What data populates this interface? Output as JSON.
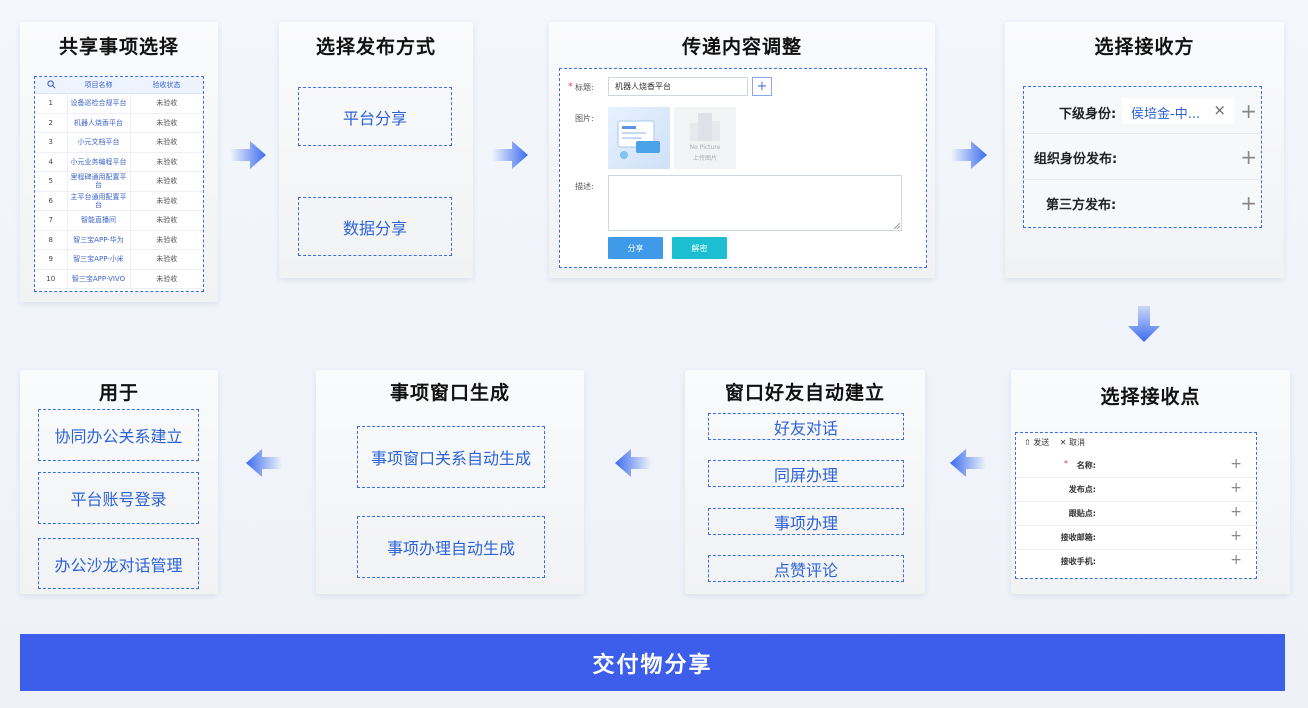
{
  "steps": {
    "s1": {
      "title": "共享事项选择",
      "table": {
        "headers": [
          "项目名称",
          "验收状态"
        ],
        "rows": [
          {
            "n": "1",
            "name": "设备巡检合规平台",
            "status": "未验收"
          },
          {
            "n": "2",
            "name": "机器人烧香平台",
            "status": "未验收"
          },
          {
            "n": "3",
            "name": "小元文档平台",
            "status": "未验收"
          },
          {
            "n": "4",
            "name": "小元业务编程平台",
            "status": "未验收"
          },
          {
            "n": "5",
            "name": "里程碑通用配置平台",
            "status": "未验收"
          },
          {
            "n": "6",
            "name": "主平台通用配置平台",
            "status": "未验收"
          },
          {
            "n": "7",
            "name": "智能直播间",
            "status": "未验收"
          },
          {
            "n": "8",
            "name": "智三宝APP-华为",
            "status": "未验收"
          },
          {
            "n": "9",
            "name": "智三宝APP-小米",
            "status": "未验收"
          },
          {
            "n": "10",
            "name": "智三宝APP-VIVO",
            "status": "未验收"
          }
        ]
      }
    },
    "s2": {
      "title": "选择发布方式",
      "items": [
        "平台分享",
        "数据分享"
      ]
    },
    "s3": {
      "title": "传递内容调整",
      "form": {
        "title_label": "标题:",
        "title_value": "机器人烧香平台",
        "image_label": "图片:",
        "no_picture": "No Picture",
        "upload_label": "上传图片",
        "desc_label": "描述:",
        "share_button": "分享",
        "decrypt_button": "解密"
      }
    },
    "s4": {
      "title": "选择接收方",
      "rows": [
        {
          "label": "下级身份:",
          "tag": "侯培金-中..."
        },
        {
          "label": "组织身份发布:"
        },
        {
          "label": "第三方发布:"
        }
      ]
    },
    "s5": {
      "title": "选择接收点",
      "toolbar": {
        "send": "发送",
        "cancel": "取消"
      },
      "rows": [
        "名称:",
        "发布点:",
        "跟贴点:",
        "接收邮箱:",
        "接收手机:"
      ]
    },
    "s6": {
      "title": "窗口好友自动建立",
      "items": [
        "好友对话",
        "同屏办理",
        "事项办理",
        "点赞评论"
      ]
    },
    "s7": {
      "title": "事项窗口生成",
      "items": [
        "事项窗口关系自动生成",
        "事项办理自动生成"
      ]
    },
    "s8": {
      "title": "用于",
      "items": [
        "协同办公关系建立",
        "平台账号登录",
        "办公沙龙对话管理"
      ]
    }
  },
  "footer": {
    "label": "交付物分享"
  },
  "colors": {
    "accent": "#3d5eea",
    "dash": "#3d6ee0",
    "arrow": "#3b6cf0"
  }
}
